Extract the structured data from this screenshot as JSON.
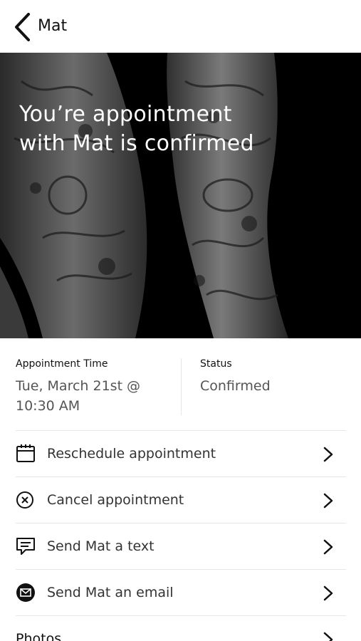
{
  "header": {
    "title": "Mat"
  },
  "hero": {
    "title": "You’re appointment with Mat is confirmed"
  },
  "appointment": {
    "time_label": "Appointment Time",
    "time_value": "Tue, March 21st @ 10:30 AM",
    "status_label": "Status",
    "status_value": "Confirmed"
  },
  "actions": [
    {
      "label": "Reschedule appointment",
      "icon": "calendar-icon"
    },
    {
      "label": "Cancel appointment",
      "icon": "cancel-circle-icon"
    },
    {
      "label": "Send Mat a text",
      "icon": "chat-bubble-icon"
    },
    {
      "label": "Send Mat an email",
      "icon": "email-icon"
    },
    {
      "label": "Photos",
      "icon": ""
    }
  ]
}
